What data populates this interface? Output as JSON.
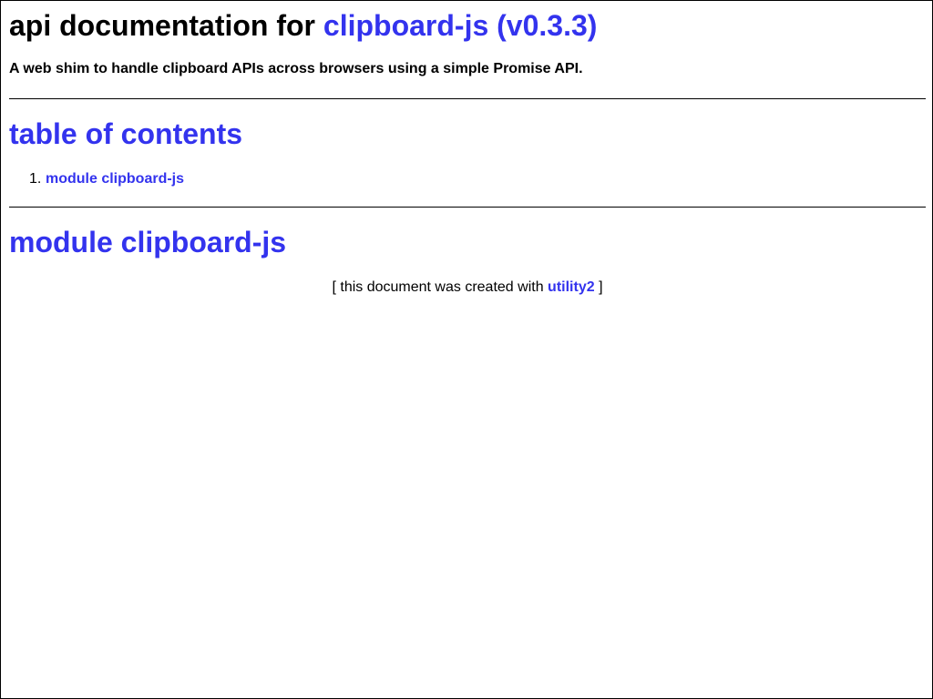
{
  "header": {
    "title_prefix": "api documentation for",
    "title_link": "clipboard-js (v0.3.3)",
    "description": "A web shim to handle clipboard APIs across browsers using a simple Promise API."
  },
  "toc": {
    "heading": "table of contents",
    "items": [
      {
        "number": "1.",
        "label": "module clipboard-js"
      }
    ]
  },
  "module": {
    "heading": "module clipboard-js"
  },
  "footer": {
    "open_bracket": "[",
    "text": "this document was created with",
    "link": "utility2",
    "close_bracket": "]"
  },
  "colors": {
    "link": "#3333ee",
    "text": "#000000",
    "background": "#ffffff"
  }
}
